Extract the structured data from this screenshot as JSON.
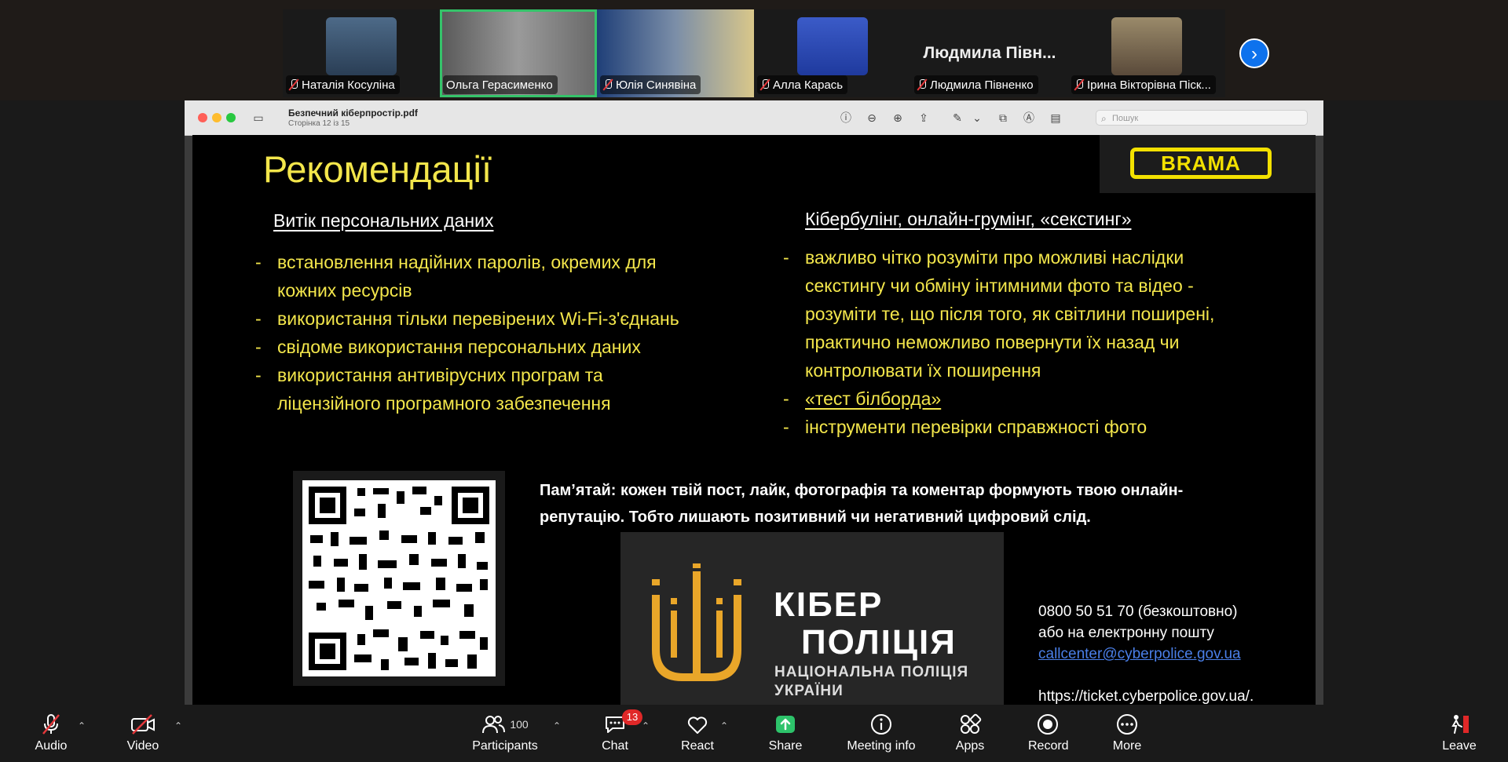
{
  "participants": [
    {
      "name": "Наталія Косуліна",
      "muted": true
    },
    {
      "name": "Ольга Герасименко",
      "muted": false,
      "active": true
    },
    {
      "name": "Юлія Синявіна",
      "muted": true
    },
    {
      "name": "Алла Карась",
      "muted": true
    },
    {
      "name": "Людмила Півненко",
      "display_name": "Людмила Півн...",
      "muted": true
    },
    {
      "name": "Ірина Вікторівна Піск...",
      "muted": true
    }
  ],
  "pdf": {
    "title": "Безпечний кіберпростір.pdf",
    "subtitle": "Сторінка 12 із 15",
    "search_placeholder": "Пошук"
  },
  "slide": {
    "title": "Рекомендації",
    "logo_text": "BRAMA",
    "left_heading": "Витік персональних даних",
    "left_items": [
      "встановлення надійних паролів, окремих для кожних ресурсів",
      "використання тільки перевірених Wi-Fi-з'єднань",
      "свідоме використання персональних даних",
      "використання антивірусних програм та ліцензійного програмного забезпечення"
    ],
    "right_heading": "Кібербулінг, онлайн-грумінг, «секстинг»",
    "right_items": [
      "важливо чітко розуміти про можливі наслідки секстингу чи обміну інтимними фото та відео - розуміти те, що після того, як світлини поширені, практично неможливо повернути їх назад чи контролювати їх поширення",
      "«тест білборда»",
      "інструменти перевірки справжності фото"
    ],
    "remember_text": "Пам’ятай: кожен твій пост, лайк, фотографія та коментар формують твою онлайн-репутацію. Тобто лишають позитивний чи негативний цифровий слід.",
    "banner": {
      "line1": "КІБЕР",
      "line2": "ПОЛІЦІЯ",
      "line3": "НАЦІОНАЛЬНА ПОЛІЦІЯ",
      "line4": "УКРАЇНИ"
    },
    "contacts": {
      "phone": "0800 50 51 70 (безкоштовно)",
      "or_email": "або на електронну пошту",
      "email": "callcenter@cyberpolice.gov.ua",
      "url": "https://ticket.cyberpolice.gov.ua/."
    }
  },
  "toolbar": {
    "audio": "Audio",
    "video": "Video",
    "participants": "Participants",
    "participants_count": "100",
    "chat": "Chat",
    "chat_badge": "13",
    "react": "React",
    "share": "Share",
    "meeting_info": "Meeting info",
    "apps": "Apps",
    "record": "Record",
    "more": "More",
    "leave": "Leave"
  },
  "colors": {
    "slide_yellow": "#f3e64b",
    "active_speaker": "#35c36a",
    "share_green": "#2dc36a",
    "zoom_blue": "#0e72ed",
    "leave_red": "#e02828"
  }
}
